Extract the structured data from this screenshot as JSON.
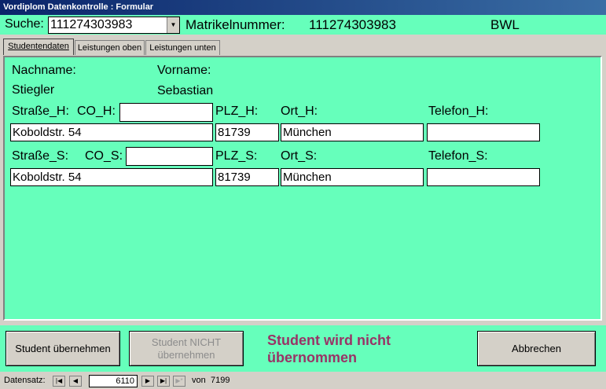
{
  "window": {
    "title": "Vordiplom Datenkontrolle : Formular"
  },
  "search": {
    "label": "Suche:",
    "value": "111274303983"
  },
  "header": {
    "matrikel_label": "Matrikelnummer:",
    "matrikel_value": "111274303983",
    "faculty": "BWL"
  },
  "tabs": [
    {
      "label": "Studentendaten",
      "active": true
    },
    {
      "label": "Leistungen oben",
      "active": false
    },
    {
      "label": "Leistungen unten",
      "active": false
    }
  ],
  "student": {
    "nachname_label": "Nachname:",
    "nachname": "Stiegler",
    "vorname_label": "Vorname:",
    "vorname": "Sebastian",
    "home": {
      "strasse_label": "Straße_H:",
      "co_label": "CO_H:",
      "co": "",
      "plz_label": "PLZ_H:",
      "ort_label": "Ort_H:",
      "telefon_label": "Telefon_H:",
      "strasse": "Koboldstr. 54",
      "plz": "81739",
      "ort": "München",
      "telefon": ""
    },
    "study": {
      "strasse_label": "Straße_S:",
      "co_label": "CO_S:",
      "co": "",
      "plz_label": "PLZ_S:",
      "ort_label": "Ort_S:",
      "telefon_label": "Telefon_S:",
      "strasse": "Koboldstr. 54",
      "plz": "81739",
      "ort": "München",
      "telefon": ""
    }
  },
  "actions": {
    "accept_label": "Student übernehmen",
    "reject_label_line1": "Student NICHT",
    "reject_label_line2": "übernehmen",
    "status_line1": "Student wird nicht",
    "status_line2": "übernommen",
    "cancel_label": "Abbrechen"
  },
  "nav": {
    "label": "Datensatz:",
    "current": "6110",
    "of_label": "von",
    "total": "7199"
  },
  "colors": {
    "form_bg": "#66ffbb",
    "status": "#993366",
    "titlebar": "#0a246a"
  }
}
